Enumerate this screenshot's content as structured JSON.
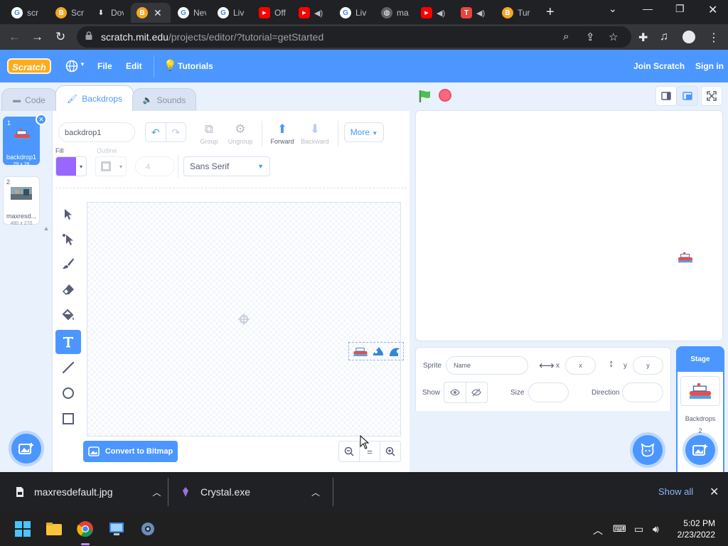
{
  "browser": {
    "tabs": [
      {
        "label": "scr",
        "fav": "G",
        "color": "#4285f4"
      },
      {
        "label": "Scr",
        "fav": "B",
        "color": "#f6a623"
      },
      {
        "label": "Dov",
        "fav": "⬇",
        "color": "#202124"
      },
      {
        "label": "",
        "fav": "B",
        "color": "#f6a623"
      },
      {
        "label": "Nev",
        "fav": "G",
        "color": "#4285f4"
      },
      {
        "label": "Liv",
        "fav": "G",
        "color": "#4285f4"
      },
      {
        "label": "Off",
        "fav": "▶",
        "color": "#ff0000"
      },
      {
        "label": "",
        "fav": "▶",
        "color": "#ff0000"
      },
      {
        "label": "Liv",
        "fav": "G",
        "color": "#4285f4"
      },
      {
        "label": "ma",
        "fav": "◍",
        "color": "#5f6368"
      },
      {
        "label": "",
        "fav": "▶",
        "color": "#ff0000"
      },
      {
        "label": "",
        "fav": "T",
        "color": "#e8453c"
      },
      {
        "label": "Tur",
        "fav": "B",
        "color": "#f6a623"
      }
    ],
    "url_host": "scratch.mit.edu",
    "url_path": "/projects/editor/?tutorial=getStarted"
  },
  "menubar": {
    "logo": "Scratch",
    "file": "File",
    "edit": "Edit",
    "tutorials": "Tutorials",
    "join": "Join Scratch",
    "signin": "Sign in"
  },
  "editor_tabs": {
    "code": "Code",
    "backdrops": "Backdrops",
    "sounds": "Sounds"
  },
  "backdrops": [
    {
      "num": "1",
      "name": "backdrop1",
      "size": "29 x 28"
    },
    {
      "num": "2",
      "name": "maxresd...",
      "size": "480 x 270"
    }
  ],
  "paint": {
    "name_value": "backdrop1",
    "group": "Group",
    "ungroup": "Ungroup",
    "forward": "Forward",
    "backward": "Backward",
    "more": "More",
    "fill_label": "Fill",
    "outline_label": "Outline",
    "fill_color": "#9966ff",
    "outline_width": "4",
    "font": "Sans Serif",
    "convert": "Convert to Bitmap",
    "zoom_reset": "="
  },
  "sprite_info": {
    "sprite_label": "Sprite",
    "name_placeholder": "Name",
    "x_label": "x",
    "x_placeholder": "x",
    "y_label": "y",
    "y_placeholder": "y",
    "show_label": "Show",
    "size_label": "Size",
    "direction_label": "Direction"
  },
  "stage_panel": {
    "title": "Stage",
    "backdrops_label": "Backdrops",
    "backdrops_count": "2"
  },
  "downloads": {
    "item1": "maxresdefault.jpg",
    "item2": "Crystal.exe",
    "show_all": "Show all"
  },
  "clock": {
    "time": "5:02 PM",
    "date": "2/23/2022"
  },
  "colors": {
    "scratch_blue": "#4c97ff",
    "fill": "#9966ff",
    "flag": "#4cbf56",
    "stop": "#ff6680"
  }
}
